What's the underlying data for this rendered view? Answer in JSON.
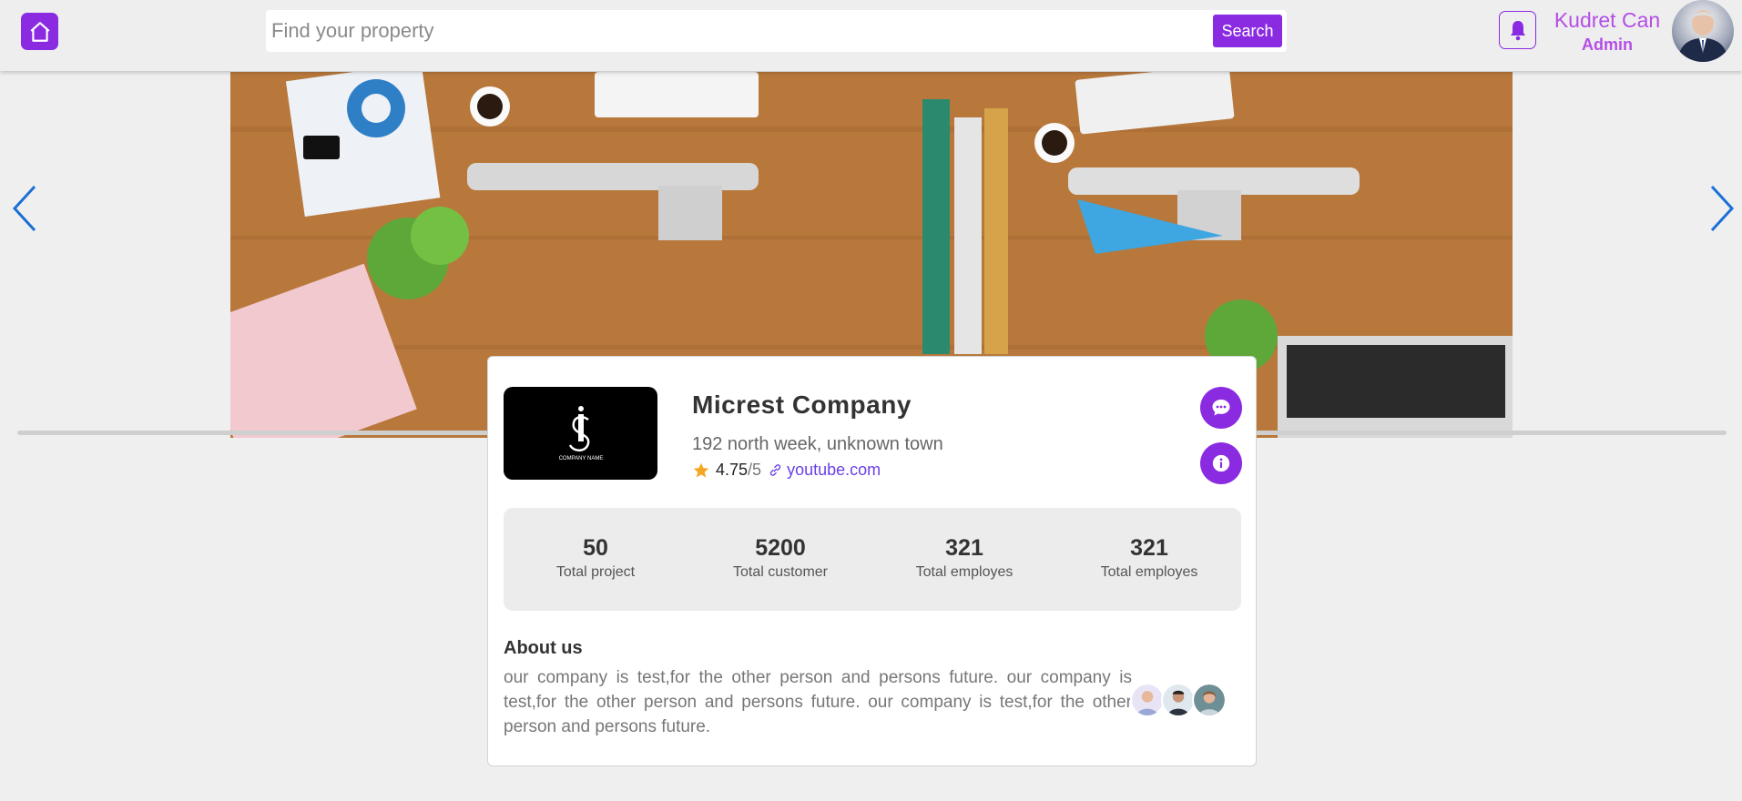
{
  "header": {
    "search_placeholder": "Find your property",
    "search_button": "Search",
    "user_name": "Kudret Can",
    "user_role": "Admin"
  },
  "company": {
    "name": "Micrest Company",
    "address": "192 north week, unknown town",
    "rating": "4.75",
    "rating_max": "/5",
    "website": "youtube.com",
    "logo_text": "COMPANY NAME"
  },
  "stats": [
    {
      "value": "50",
      "label": "Total project"
    },
    {
      "value": "5200",
      "label": "Total customer"
    },
    {
      "value": "321",
      "label": "Total employes"
    },
    {
      "value": "321",
      "label": "Total employes"
    }
  ],
  "about": {
    "title": "About us",
    "text": "our company is test,for the other person and persons future. our company is test,for the other person and persons future. our company is test,for the other person and persons future."
  },
  "colors": {
    "accent": "#8a2be2",
    "user_text": "#b44ee6",
    "arrow": "#1a6fd6",
    "star": "#f5a623",
    "link": "#6a40e8"
  },
  "icons": {
    "home": "home-icon",
    "bell": "bell-icon",
    "chat": "chat-icon",
    "info": "info-icon",
    "star": "star-icon",
    "link": "link-icon",
    "prev": "chevron-left-icon",
    "next": "chevron-right-icon"
  }
}
